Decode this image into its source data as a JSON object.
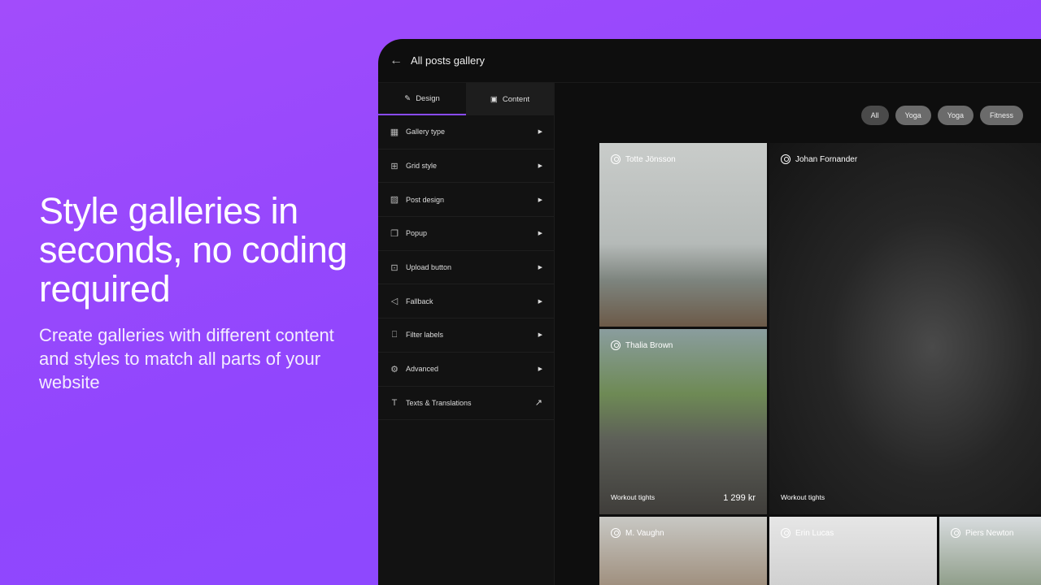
{
  "hero": {
    "title": "Style galleries in seconds, no coding required",
    "subtitle": "Create galleries with different content and styles to match all parts of your website"
  },
  "header": {
    "title": "All posts gallery",
    "back_icon": "arrow-left-icon"
  },
  "tabs": [
    {
      "label": "Design",
      "icon": "brush-icon"
    },
    {
      "label": "Content",
      "icon": "image-icon"
    }
  ],
  "menu": [
    {
      "label": "Gallery type",
      "icon": "grid-icon"
    },
    {
      "label": "Grid style",
      "icon": "table-icon"
    },
    {
      "label": "Post design",
      "icon": "image-icon"
    },
    {
      "label": "Popup",
      "icon": "popup-icon"
    },
    {
      "label": "Upload button",
      "icon": "upload-icon"
    },
    {
      "label": "Fallback",
      "icon": "fallback-icon"
    },
    {
      "label": "Filter labels",
      "icon": "bookmark-icon"
    },
    {
      "label": "Advanced",
      "icon": "gear-icon"
    },
    {
      "label": "Texts & Translations",
      "icon": "text-icon"
    }
  ],
  "filters": [
    "All",
    "Yoga",
    "Yoga",
    "Fitness"
  ],
  "posts": [
    {
      "author": "Totte Jönsson"
    },
    {
      "author": "Johan Fornander",
      "caption": "Workout tights"
    },
    {
      "author": "Thalia Brown",
      "caption": "Workout tights",
      "price": "1 299 kr"
    },
    {
      "author": "M. Vaughn"
    },
    {
      "author": "Erin Lucas"
    },
    {
      "author": "Piers Newton"
    }
  ]
}
